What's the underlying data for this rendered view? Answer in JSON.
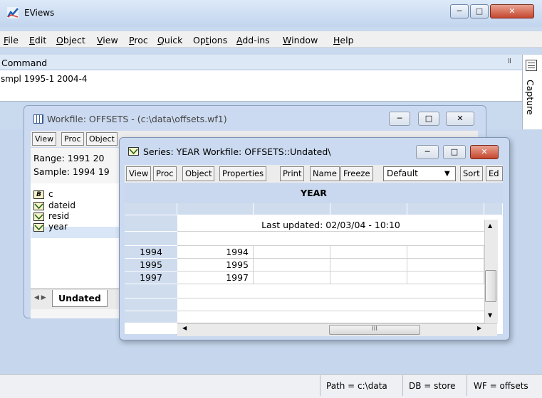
{
  "app": {
    "title": "EViews"
  },
  "menu": [
    {
      "pre": "",
      "u": "F",
      "post": "ile"
    },
    {
      "pre": "",
      "u": "E",
      "post": "dit"
    },
    {
      "pre": "",
      "u": "O",
      "post": "bject"
    },
    {
      "pre": "",
      "u": "V",
      "post": "iew"
    },
    {
      "pre": "",
      "u": "P",
      "post": "roc"
    },
    {
      "pre": "",
      "u": "Q",
      "post": "uick"
    },
    {
      "pre": "Op",
      "u": "t",
      "post": "ions"
    },
    {
      "pre": "",
      "u": "A",
      "post": "dd-ins"
    },
    {
      "pre": "",
      "u": "W",
      "post": "indow"
    },
    {
      "pre": "",
      "u": "H",
      "post": "elp"
    }
  ],
  "command": {
    "label": "Command",
    "pin": "Ⅱ",
    "text": "smpl 1995-1 2004-4"
  },
  "capture": {
    "label": "Capture"
  },
  "workfile": {
    "title": "Workfile: OFFSETS - (c:\\data\\offsets.wf1)",
    "toolbar": [
      "View",
      "Proc",
      "Object"
    ],
    "range": "Range:  1991 20",
    "sample": "Sample: 1994 19",
    "objects": [
      {
        "icon": "B",
        "name": "c"
      },
      {
        "icon": "",
        "name": "dateid"
      },
      {
        "icon": "",
        "name": "resid"
      },
      {
        "icon": "",
        "name": "year"
      }
    ],
    "tab": "Undated"
  },
  "series": {
    "title": "Series: YEAR   Workfile: OFFSETS::Undated\\",
    "toolbar": [
      "View",
      "Proc",
      "Object",
      "Properties",
      "Print",
      "Name",
      "Freeze",
      "Sort",
      "Ed"
    ],
    "dropdown": "Default",
    "header": "YEAR",
    "last_updated": "Last updated: 02/03/04 - 10:10",
    "rows": [
      {
        "obs": "1994",
        "value": "1994"
      },
      {
        "obs": "1995",
        "value": "1995"
      },
      {
        "obs": "1997",
        "value": "1997"
      }
    ],
    "hscroll_glyph": "III"
  },
  "status": {
    "path": "Path = c:\\data",
    "db": "DB = store",
    "wf": "WF = offsets"
  },
  "colors": {
    "accent": "#c9d9ee",
    "close": "#c4472f"
  }
}
